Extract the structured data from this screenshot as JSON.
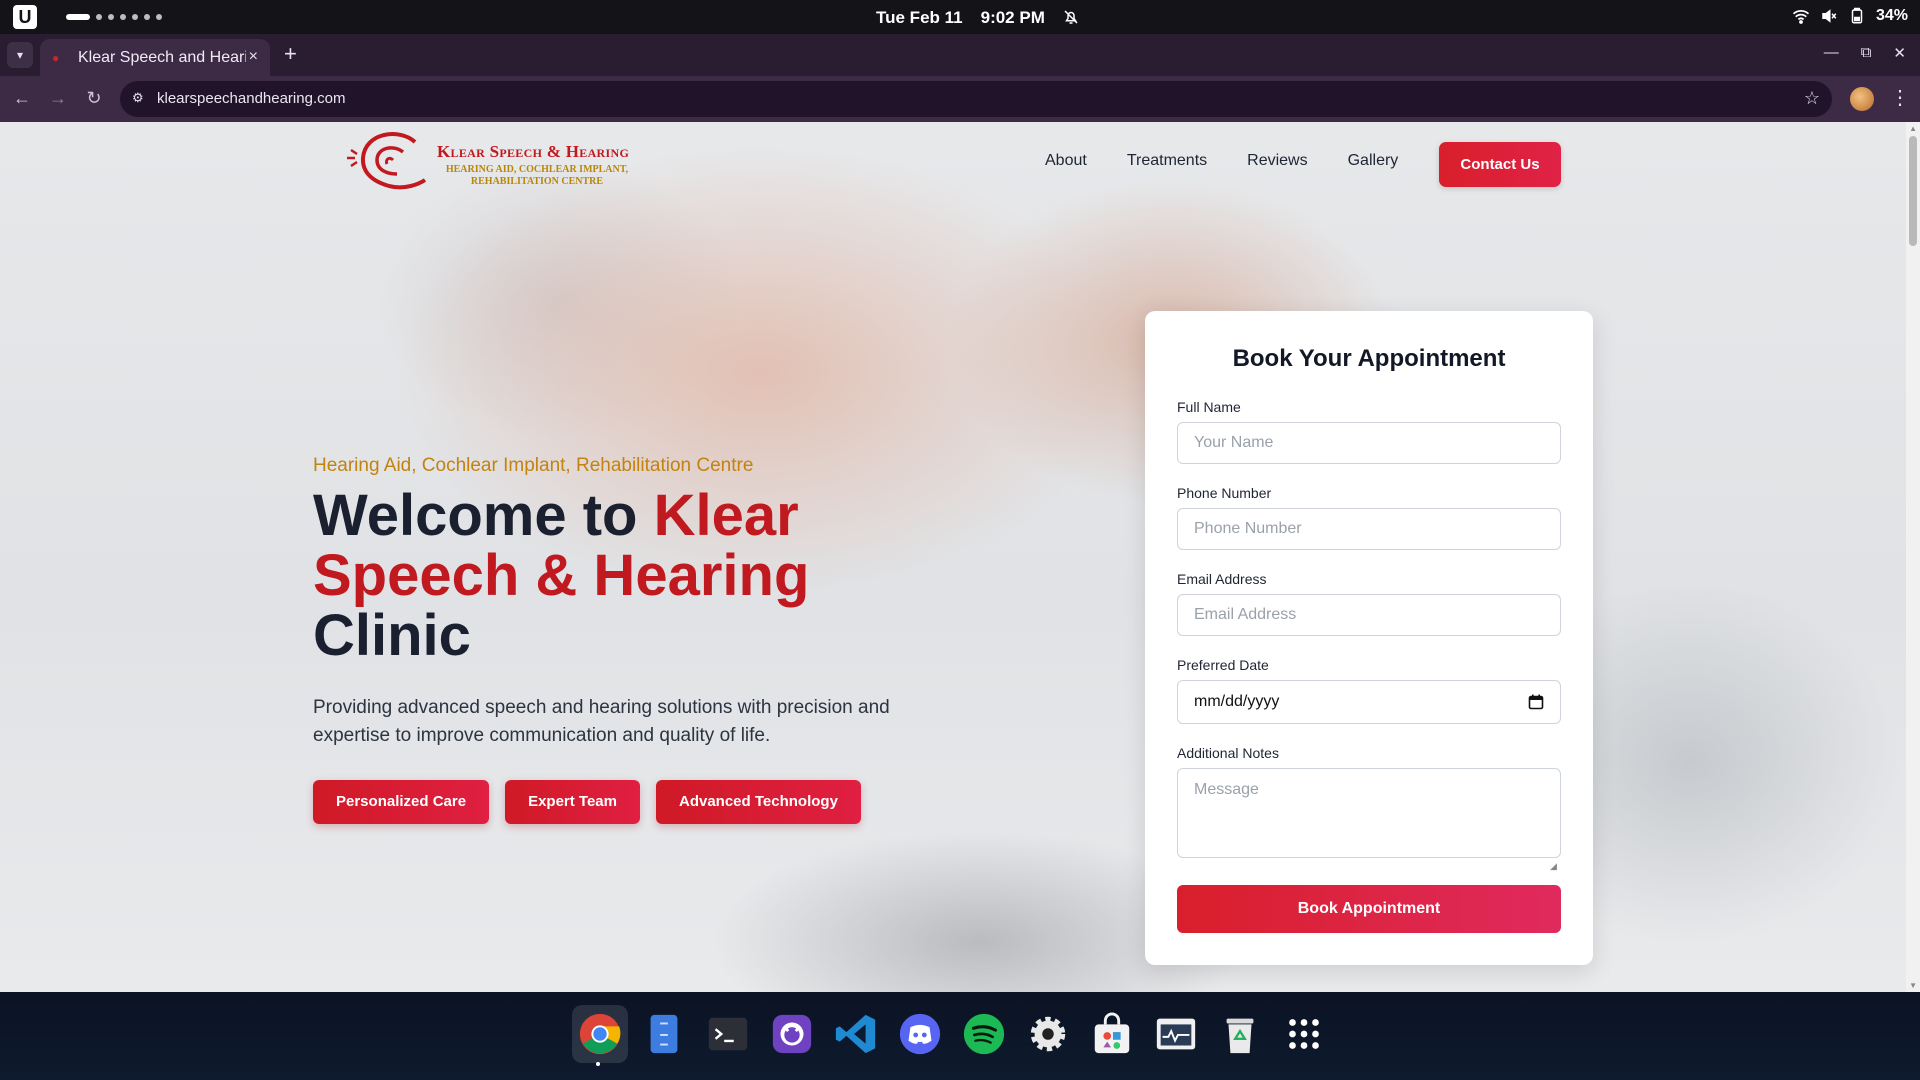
{
  "system": {
    "date": "Tue Feb 11",
    "time": "9:02 PM",
    "battery": "34%"
  },
  "browser": {
    "tab_title": "Klear Speech and Hearing",
    "tab_close": "×",
    "new_tab": "+",
    "url": "klearspeechandhearing.com"
  },
  "site": {
    "logo": {
      "name": "Klear Speech & Hearing",
      "subtitle": "HEARING AID, COCHLEAR IMPLANT, REHABILITATION CENTRE"
    },
    "nav": [
      "About",
      "Treatments",
      "Reviews",
      "Gallery"
    ],
    "contact_label": "Contact Us",
    "hero": {
      "tagline": "Hearing Aid, Cochlear Implant, Rehabilitation Centre",
      "title_part1": "Welcome to ",
      "title_accent": "Klear Speech & Hearing",
      "title_part2": " Clinic",
      "description": "Providing advanced speech and hearing solutions with precision and expertise to improve communication and quality of life.",
      "pills": [
        "Personalized Care",
        "Expert Team",
        "Advanced Technology"
      ]
    },
    "form": {
      "title": "Book Your Appointment",
      "name_label": "Full Name",
      "name_placeholder": "Your Name",
      "phone_label": "Phone Number",
      "phone_placeholder": "Phone Number",
      "email_label": "Email Address",
      "email_placeholder": "Email Address",
      "date_label": "Preferred Date",
      "date_value": "mm/dd/yyyy",
      "notes_label": "Additional Notes",
      "notes_placeholder": "Message",
      "submit_label": "Book Appointment"
    }
  },
  "dock": {
    "apps": [
      "chrome",
      "files",
      "terminal",
      "github-desktop",
      "vscode",
      "discord",
      "spotify",
      "settings",
      "app-store",
      "system-monitor",
      "trash",
      "app-grid"
    ]
  },
  "colors": {
    "brand_red": "#c0191f",
    "button_red": "#d91f2b",
    "tagline_gold": "#c28310",
    "browser_chrome": "#3d2b46"
  }
}
